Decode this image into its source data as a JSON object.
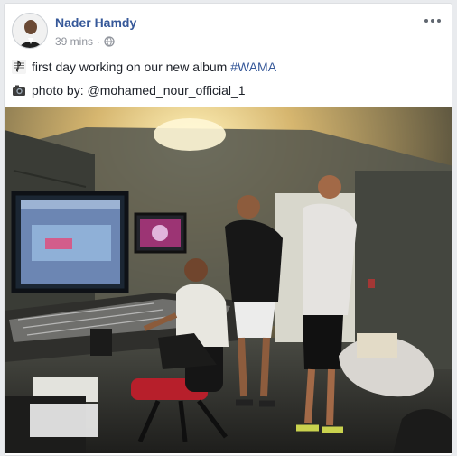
{
  "post": {
    "author": "Nader Hamdy",
    "time": "39 mins",
    "separator": "·",
    "privacy_icon": "globe-icon",
    "line1": {
      "icon": "music-note-icon",
      "text": "first day working on our new album ",
      "hashtag": "#WAMA"
    },
    "line2": {
      "icon": "camera-icon",
      "text": "photo by: @mohamed_nour_official_1"
    },
    "image": {
      "description_icon": "studio-photo"
    }
  },
  "colors": {
    "link": "#365899",
    "text": "#1d2129",
    "meta": "#90949c"
  }
}
